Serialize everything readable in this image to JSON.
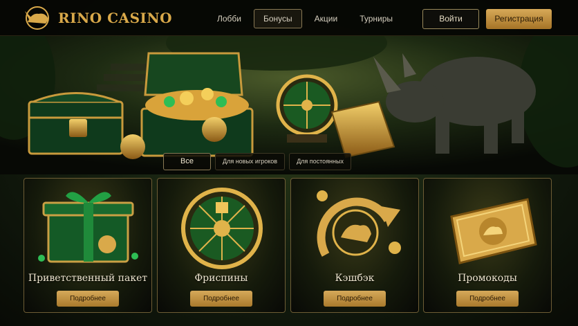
{
  "brand": {
    "name": "RINO CASINO",
    "logo_icon": "rhino-logo-icon"
  },
  "header": {
    "nav": [
      {
        "label": "Лобби",
        "active": false
      },
      {
        "label": "Бонусы",
        "active": true
      },
      {
        "label": "Акции",
        "active": false
      },
      {
        "label": "Турниры",
        "active": false
      }
    ],
    "login_label": "Войти",
    "register_label": "Регистрация"
  },
  "filters": [
    {
      "label": "Все",
      "active": true
    },
    {
      "label": "Для новых игроков",
      "active": false
    },
    {
      "label": "Для постоянных",
      "active": false
    }
  ],
  "cards": [
    {
      "title": "Приветственный пакет",
      "button": "Подробнее",
      "icon": "gift-box-icon"
    },
    {
      "title": "Фриспины",
      "button": "Подробнее",
      "icon": "fortune-wheel-icon"
    },
    {
      "title": "Кэшбэк",
      "button": "Подробнее",
      "icon": "cashback-arrow-icon"
    },
    {
      "title": "Промокоды",
      "button": "Подробнее",
      "icon": "promo-ticket-icon"
    }
  ],
  "colors": {
    "gold": "#d9a94a",
    "dark": "#0a0b06",
    "jungle": "#1e2c12",
    "emerald": "#1f6b2a"
  }
}
